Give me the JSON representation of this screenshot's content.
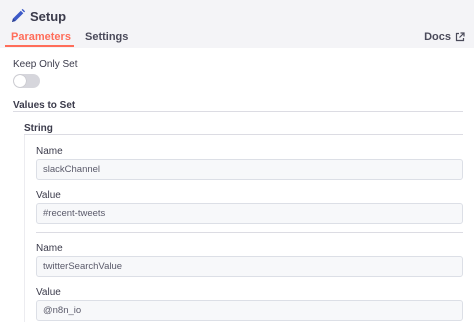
{
  "header": {
    "title": "Setup",
    "tabs": [
      {
        "label": "Parameters",
        "active": true
      },
      {
        "label": "Settings",
        "active": false
      }
    ],
    "docs_label": "Docs"
  },
  "params": {
    "keep_only_set": {
      "label": "Keep Only Set",
      "value": false
    },
    "values_to_set": {
      "label": "Values to Set",
      "type_label": "String",
      "entries": [
        {
          "name_label": "Name",
          "name": "slackChannel",
          "value_label": "Value",
          "value": "#recent-tweets"
        },
        {
          "name_label": "Name",
          "name": "twitterSearchValue",
          "value_label": "Value",
          "value": "@n8n_io"
        }
      ]
    }
  },
  "colors": {
    "accent": "#ff6d5a",
    "header_bg": "#f4f4f7",
    "input_bg": "#f7f8fa",
    "toggle_off": "#d6d6dc"
  },
  "icons": {
    "title_icon": "pencil-icon",
    "docs_icon": "external-link-icon"
  }
}
